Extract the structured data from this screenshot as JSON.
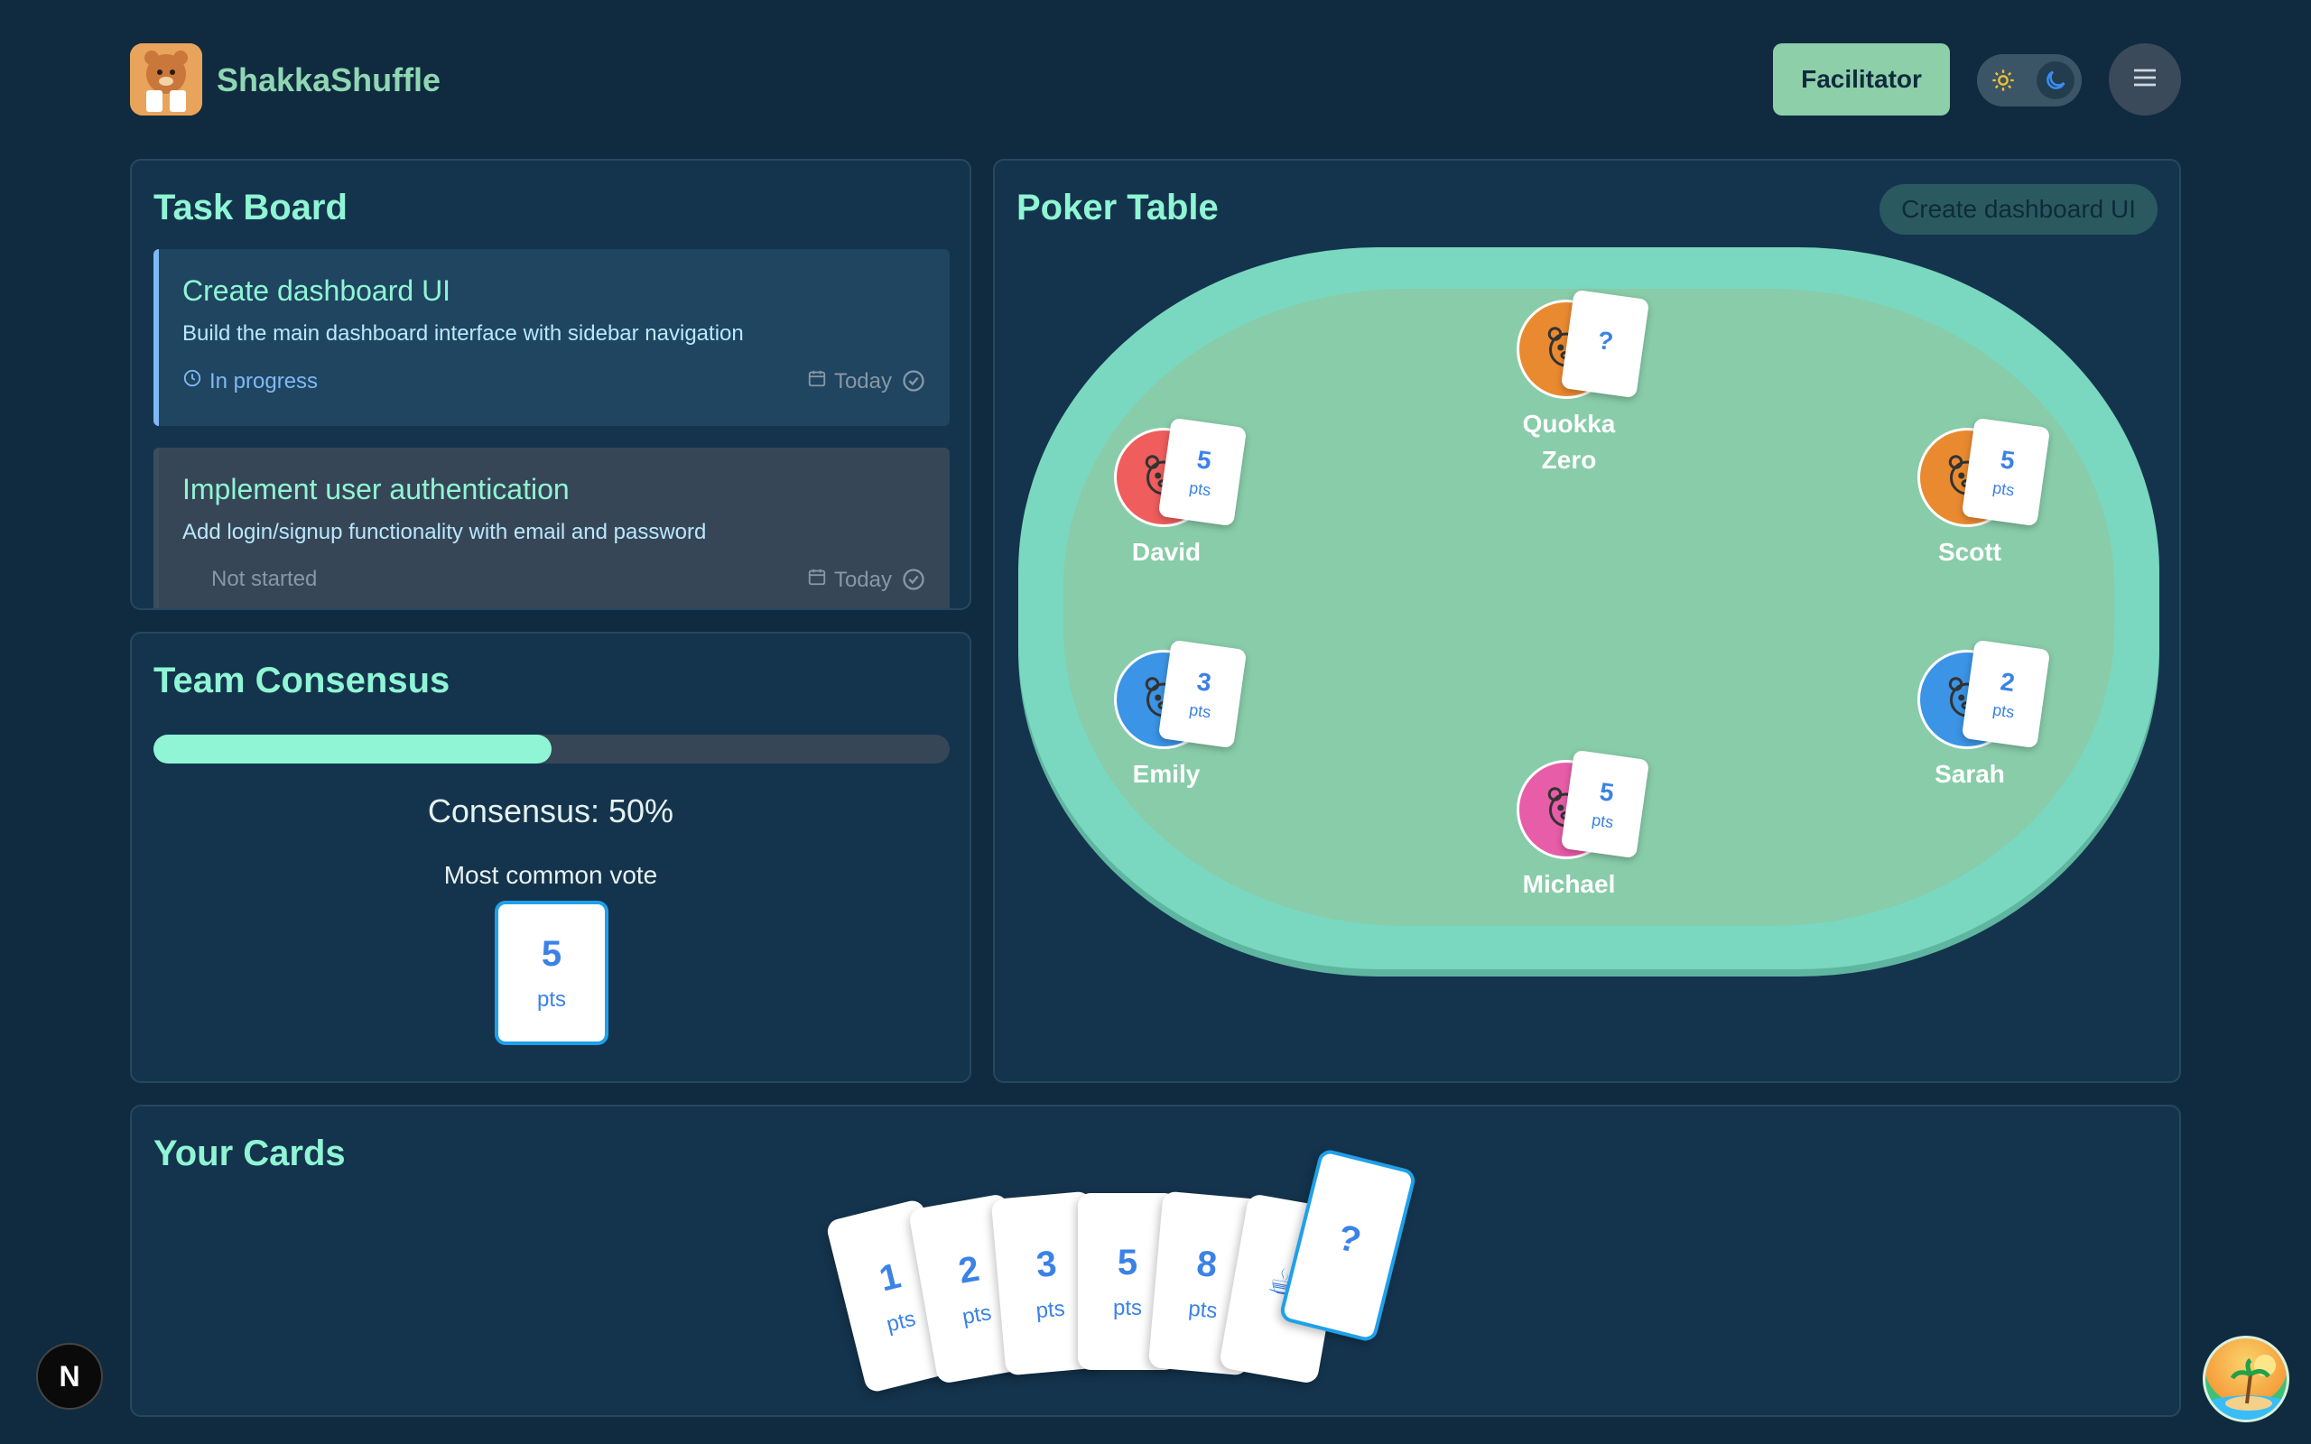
{
  "app": {
    "name": "ShakkaShuffle"
  },
  "header": {
    "facilitator_label": "Facilitator"
  },
  "taskboard": {
    "title": "Task Board",
    "tasks": [
      {
        "title": "Create dashboard UI",
        "description": "Build the main dashboard interface with sidebar navigation",
        "status": "In progress",
        "date": "Today"
      },
      {
        "title": "Implement user authentication",
        "description": "Add login/signup functionality with email and password",
        "status": "Not started",
        "date": "Today"
      }
    ]
  },
  "consensus": {
    "title": "Team Consensus",
    "percent": 50,
    "text": "Consensus: 50%",
    "common_label": "Most common vote",
    "common_value": "5",
    "common_unit": "pts"
  },
  "poker": {
    "title": "Poker Table",
    "current_task": "Create dashboard UI",
    "players": [
      {
        "name": "Quokka Zero",
        "vote": "?",
        "unit": "",
        "color": "#ea8a30"
      },
      {
        "name": "David",
        "vote": "5",
        "unit": "pts",
        "color": "#ef5d5d"
      },
      {
        "name": "Scott",
        "vote": "5",
        "unit": "pts",
        "color": "#ea8a30"
      },
      {
        "name": "Emily",
        "vote": "3",
        "unit": "pts",
        "color": "#3b94e6"
      },
      {
        "name": "Sarah",
        "vote": "2",
        "unit": "pts",
        "color": "#3b94e6"
      },
      {
        "name": "Michael",
        "vote": "5",
        "unit": "pts",
        "color": "#e85da8"
      }
    ]
  },
  "yourcards": {
    "title": "Your Cards",
    "cards": [
      {
        "value": "1",
        "unit": "pts"
      },
      {
        "value": "2",
        "unit": "pts"
      },
      {
        "value": "3",
        "unit": "pts"
      },
      {
        "value": "5",
        "unit": "pts"
      },
      {
        "value": "8",
        "unit": "pts"
      },
      {
        "value": "☕",
        "unit": ""
      },
      {
        "value": "?",
        "unit": ""
      }
    ],
    "selected": "?"
  },
  "badges": {
    "next": "N"
  },
  "colors": {
    "background": "#102b3f",
    "accent": "#8ff5d4",
    "card_text": "#3b82e6",
    "selected_border": "#1fa0ea"
  }
}
